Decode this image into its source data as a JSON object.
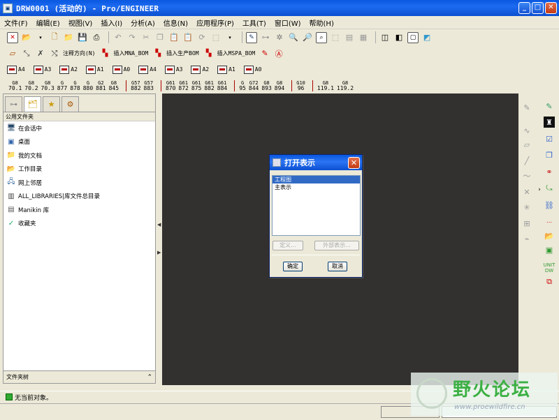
{
  "window": {
    "title": "DRW0001 (活动的) - Pro/ENGINEER"
  },
  "menu": [
    "文件(F)",
    "编辑(E)",
    "视图(V)",
    "插入(I)",
    "分析(A)",
    "信息(N)",
    "应用程序(P)",
    "工具(T)",
    "窗口(W)",
    "帮助(H)"
  ],
  "toolbar2": {
    "note_direction": "注释方向(N)",
    "insert_mna_bom": "插入MNA_BOM",
    "insert_production_bom": "插入生产BOM",
    "insert_mspa_bom": "插入MSPA_BOM"
  },
  "toolbar3": [
    "A4",
    "A3",
    "A2",
    "A1",
    "A0",
    "A4",
    "A3",
    "A2",
    "A1",
    "A0"
  ],
  "gdt": [
    [
      "G8",
      "70.1"
    ],
    [
      "G8",
      "70.2"
    ],
    [
      "G8",
      "70.3"
    ],
    [
      "G",
      "877"
    ],
    [
      "G",
      "878"
    ],
    [
      "G",
      "880"
    ],
    [
      "G2",
      "881"
    ],
    [
      "G8",
      "845"
    ],
    [
      "G57",
      "882"
    ],
    [
      "G57",
      "883"
    ],
    [
      "G61",
      "870"
    ],
    [
      "G61",
      "872"
    ],
    [
      "G61",
      "875"
    ],
    [
      "G61",
      "882"
    ],
    [
      "G61",
      "884"
    ],
    [
      "G",
      "95"
    ],
    [
      "G72",
      "844"
    ],
    [
      "G8",
      "893"
    ],
    [
      "G8",
      "894"
    ],
    [
      "G10",
      "96"
    ],
    [
      "G8",
      "119.1"
    ],
    [
      "G8",
      "119.2"
    ]
  ],
  "left_panel": {
    "header": "公用文件夹",
    "items": [
      {
        "label": "在会话中",
        "icon": "monitor-icon"
      },
      {
        "label": "桌面",
        "icon": "desktop-icon"
      },
      {
        "label": "我的文档",
        "icon": "folder-icon"
      },
      {
        "label": "工作目录",
        "icon": "working-dir-icon"
      },
      {
        "label": "网上邻居",
        "icon": "network-icon"
      },
      {
        "label": "ALL_LIBRARIES|库文件总目录",
        "icon": "library-icon"
      },
      {
        "label": "Manikin 库",
        "icon": "manikin-icon"
      },
      {
        "label": "收藏夹",
        "icon": "favorites-icon"
      }
    ],
    "footer": "文件夹树"
  },
  "dialog": {
    "title": "打开表示",
    "list": [
      "工程图",
      "主表示"
    ],
    "selected_index": 0,
    "define_label": "定义...",
    "external_label": "外部表示...",
    "ok_label": "确定",
    "cancel_label": "取消"
  },
  "status": {
    "message": "无当前对象。"
  },
  "watermark": {
    "text": "野火论坛",
    "url": "www.proewildfire.cn"
  },
  "colors": {
    "graphics_bg": "#333130",
    "titlebar": "#0a58e0",
    "selection": "#316ac5"
  }
}
